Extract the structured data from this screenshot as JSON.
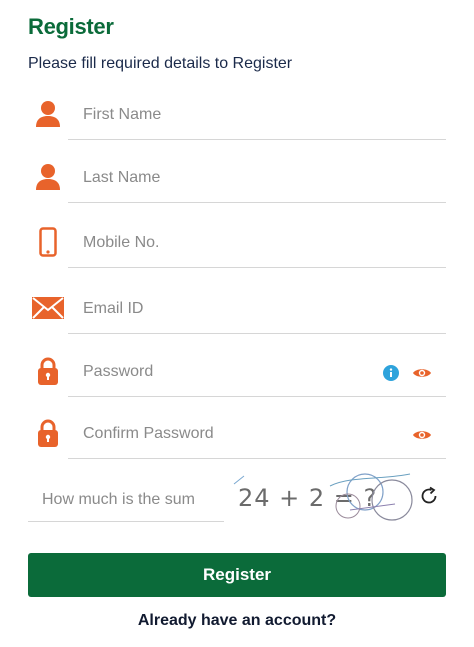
{
  "header": {
    "title": "Register",
    "subtitle": "Please fill required details to Register"
  },
  "form": {
    "first_name": {
      "placeholder": "First Name",
      "value": "",
      "icon": "user-icon"
    },
    "last_name": {
      "placeholder": "Last Name",
      "value": "",
      "icon": "user-icon"
    },
    "mobile": {
      "placeholder": "Mobile No.",
      "value": "",
      "icon": "mobile-phone-icon"
    },
    "email": {
      "placeholder": "Email ID",
      "value": "",
      "icon": "envelope-icon"
    },
    "password": {
      "placeholder": "Password",
      "value": "",
      "icon": "lock-icon"
    },
    "confirm_password": {
      "placeholder": "Confirm Password",
      "value": "",
      "icon": "lock-icon"
    },
    "captcha": {
      "placeholder": "How much is the sum",
      "value": "",
      "question": "24 + 2 = ?"
    },
    "register_label": "Register"
  },
  "footer": {
    "login_prompt": "Already have an account?"
  },
  "colors": {
    "brand_green": "#0b6b3a",
    "icon_orange": "#e8632b",
    "info_blue": "#2ea3dc",
    "text_dark": "#1b2a4a"
  }
}
